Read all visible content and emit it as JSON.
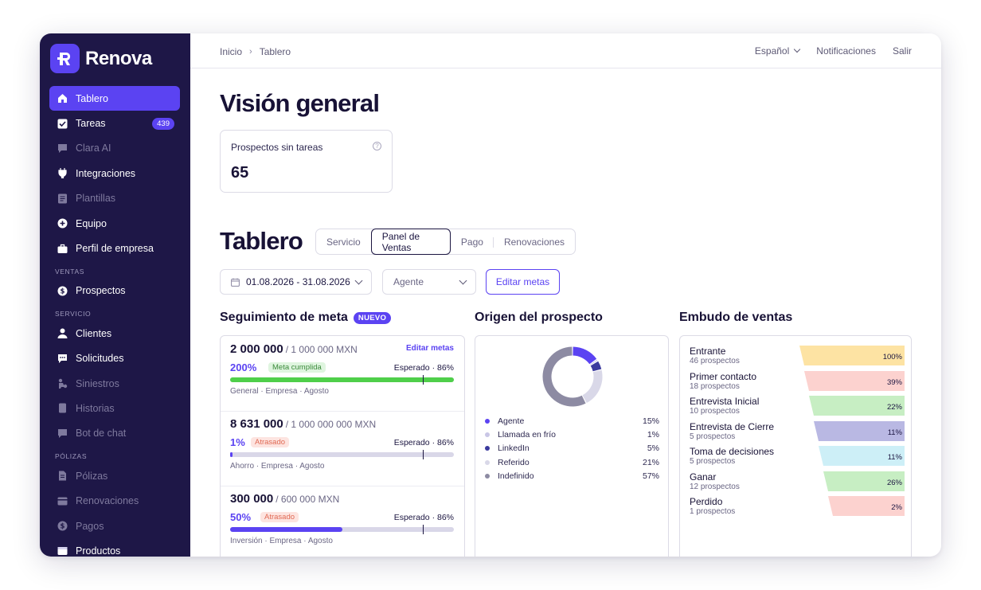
{
  "app": {
    "name": "Renova"
  },
  "sidebar": {
    "items": [
      {
        "label": "Tablero",
        "icon": "home-icon"
      },
      {
        "label": "Tareas",
        "icon": "checkbox-icon",
        "badge": "439"
      },
      {
        "label": "Clara AI",
        "icon": "chat-icon"
      },
      {
        "label": "Integraciones",
        "icon": "plug-icon"
      },
      {
        "label": "Plantillas",
        "icon": "template-icon"
      },
      {
        "label": "Equipo",
        "icon": "plus-circle-icon"
      },
      {
        "label": "Perfil de empresa",
        "icon": "briefcase-icon"
      }
    ],
    "section_ventas": "VENTAS",
    "ventas_items": [
      {
        "label": "Prospectos",
        "icon": "dollar-icon"
      }
    ],
    "section_servicio": "SERVICIO",
    "servicio_items": [
      {
        "label": "Clientes",
        "icon": "user-icon"
      },
      {
        "label": "Solicitudes",
        "icon": "message-icon"
      },
      {
        "label": "Siniestros",
        "icon": "car-icon"
      },
      {
        "label": "Historias",
        "icon": "document-icon"
      },
      {
        "label": "Bot de chat",
        "icon": "chat-icon"
      }
    ],
    "section_polizas": "PÓLIZAS",
    "polizas_items": [
      {
        "label": "Pólizas",
        "icon": "policy-icon"
      },
      {
        "label": "Renovaciones",
        "icon": "wallet-icon"
      },
      {
        "label": "Pagos",
        "icon": "dollar-icon"
      },
      {
        "label": "Productos",
        "icon": "box-icon"
      }
    ]
  },
  "topbar": {
    "breadcrumb": [
      "Inicio",
      "Tablero"
    ],
    "language": "Español",
    "notifications": "Notificaciones",
    "logout": "Salir"
  },
  "overview": {
    "title": "Visión general",
    "kpi_label": "Prospectos sin tareas",
    "kpi_value": "65"
  },
  "dashboard": {
    "title": "Tablero",
    "tabs": [
      "Servicio",
      "Panel de Ventas",
      "Pago",
      "Renovaciones"
    ],
    "selected_tab": "Panel de Ventas",
    "date_range": "01.08.2026 - 31.08.2026",
    "agent_placeholder": "Agente",
    "edit_goals": "Editar metas"
  },
  "goals": {
    "title": "Seguimiento de meta",
    "badge": "NUEVO",
    "edit_link": "Editar metas",
    "items": [
      {
        "amount": "2 000 000",
        "total": "/ 1 000 000 MXN",
        "pct": "200%",
        "status": "Meta cumplida",
        "status_kind": "ok",
        "expected": "Esperado · 86%",
        "progress": 1.0,
        "expected_mark": 0.86,
        "meta": "General · Empresa · Agosto"
      },
      {
        "amount": "8 631 000",
        "total": "/ 1 000 000 000 MXN",
        "pct": "1%",
        "status": "Atrasado",
        "status_kind": "late",
        "expected": "Esperado · 86%",
        "progress": 0.01,
        "expected_mark": 0.86,
        "meta": "Ahorro · Empresa · Agosto"
      },
      {
        "amount": "300 000",
        "total": "/ 600 000 MXN",
        "pct": "50%",
        "status": "Atrasado",
        "status_kind": "late",
        "expected": "Esperado · 86%",
        "progress": 0.5,
        "expected_mark": 0.86,
        "meta": "Inversión · Empresa · Agosto"
      }
    ]
  },
  "origin": {
    "title": "Origen del prospecto",
    "items": [
      {
        "label": "Agente",
        "value": "15%",
        "share": 15,
        "color": "#5b43f2"
      },
      {
        "label": "Llamada en frío",
        "value": "1%",
        "share": 1,
        "color": "#c9c6e6"
      },
      {
        "label": "LinkedIn",
        "value": "5%",
        "share": 5,
        "color": "#3b3a9e"
      },
      {
        "label": "Referido",
        "value": "21%",
        "share": 21,
        "color": "#d9d8e8"
      },
      {
        "label": "Indefinido",
        "value": "57%",
        "share": 57,
        "color": "#8d8ba3"
      }
    ]
  },
  "funnel": {
    "title": "Embudo de ventas",
    "stages": [
      {
        "name": "Entrante",
        "sub": "46 prospectos",
        "pct": "100%",
        "color": "#fde3a3"
      },
      {
        "name": "Primer contacto",
        "sub": "18 prospectos",
        "pct": "39%",
        "color": "#fcd2cf"
      },
      {
        "name": "Entrevista Inicial",
        "sub": "10 prospectos",
        "pct": "22%",
        "color": "#c7eec3"
      },
      {
        "name": "Entrevista de Cierre",
        "sub": "5 prospectos",
        "pct": "11%",
        "color": "#b9b8e3"
      },
      {
        "name": "Toma de decisiones",
        "sub": "5 prospectos",
        "pct": "11%",
        "color": "#cdeff7"
      },
      {
        "name": "Ganar",
        "sub": "12 prospectos",
        "pct": "26%",
        "color": "#c7eec3"
      },
      {
        "name": "Perdido",
        "sub": "1 prospectos",
        "pct": "2%",
        "color": "#fcd2cf"
      }
    ]
  }
}
